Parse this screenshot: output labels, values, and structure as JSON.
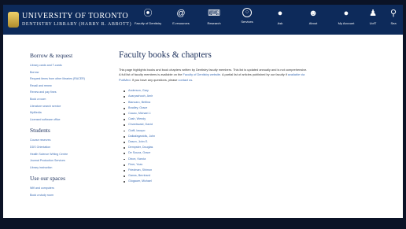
{
  "header": {
    "university": "UNIVERSITY OF TORONTO",
    "library": "DENTISTRY LIBRARY (HARRY R. ABBOTT)"
  },
  "nav": [
    {
      "label": "Faculty of Dentistry",
      "icon": "tooth-icon",
      "glyph": "⦿"
    },
    {
      "label": "E-resources",
      "icon": "at-sign-icon",
      "glyph": "@"
    },
    {
      "label": "Research",
      "icon": "keyboard-icon",
      "glyph": "⌨"
    },
    {
      "label": "Services",
      "icon": "circle-icon",
      "glyph": "○"
    },
    {
      "label": "Ask",
      "icon": "chat-bubble-icon",
      "glyph": "●"
    },
    {
      "label": "About",
      "icon": "about-people-icon",
      "glyph": "☻"
    },
    {
      "label": "My Account",
      "icon": "account-icon",
      "glyph": "●"
    },
    {
      "label": "UofT",
      "icon": "person-icon",
      "glyph": "♟"
    },
    {
      "label": "Sea",
      "icon": "search-icon",
      "glyph": "⚲"
    }
  ],
  "sidebar": {
    "sections": [
      {
        "heading": "Borrow & request",
        "links": [
          "Library cards and T-cards",
          "Borrow",
          "Request items from other libraries (RACER)",
          "Recall and renew",
          "Renew and pay fines",
          "Book a room",
          "Literature search service",
          "MyMedia",
          "Licensed software office"
        ]
      },
      {
        "heading": "Students",
        "links": [
          "Course reserves",
          "DDS Orientation",
          "Health Science Writing Centre",
          "Journal Production Services",
          "Library instruction"
        ]
      },
      {
        "heading": "Use our spaces",
        "links": [
          "Wifi and computers",
          "Book a study room"
        ]
      }
    ]
  },
  "main": {
    "title": "Faculty books & chapters",
    "intro_part1": "This page highlights books and book chapters written by Dentistry faculty members. This list is updated annually and is not comprehensive. A full list of faculty members is available on the ",
    "intro_link1": "Faculty of Dentistry website",
    "intro_part2": ". A partial list of articles published by our faculty if ",
    "intro_link2": "available via PubMed",
    "intro_part3": ". If you have any questions, please ",
    "intro_link3": "contact us",
    "intro_part4": ".",
    "faculty": [
      "Anderson, Gary",
      "Azarpazhooh, Amir",
      "Biancaro, Bettina",
      "Bradley, Grace",
      "Cacao, Michael J.",
      "Cash, Wendy",
      "Chvartszaid, David",
      "Cioffi, Iacopo",
      "Dalkafaganidis, John",
      "Dason, John E.",
      "Dempster, Douglas",
      "De Souza, Grace",
      "Dixon, Karola",
      "Finer, Yoav",
      "Friedman, Shimon",
      "Ganss, Bernhard",
      "Glogauer, Michael"
    ]
  }
}
